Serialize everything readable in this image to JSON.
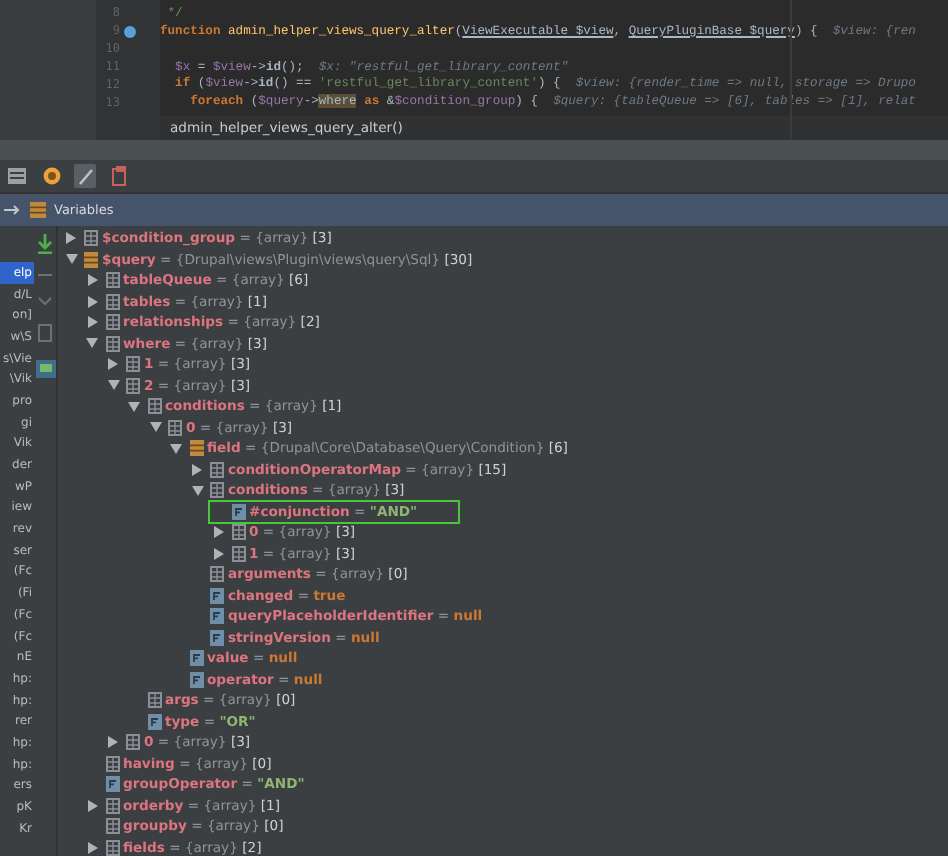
{
  "editor": {
    "lines": [
      {
        "number": "8",
        "tokens": [
          {
            "kind": "comment",
            "text": " */"
          }
        ]
      },
      {
        "number": "9",
        "breakpoint": true,
        "tokens": [
          {
            "kind": "keyword",
            "text": "function "
          },
          {
            "kind": "function",
            "text": "admin_helper_views_query_alter"
          },
          {
            "kind": "plain",
            "text": "("
          },
          {
            "kind": "type",
            "text": "ViewExecutable $view"
          },
          {
            "kind": "plain",
            "text": ", "
          },
          {
            "kind": "type",
            "text": "QueryPluginBase $query"
          },
          {
            "kind": "plain",
            "text": ") {  "
          },
          {
            "kind": "hint",
            "text": "$view: {ren"
          }
        ]
      },
      {
        "number": "10"
      },
      {
        "number": "11",
        "tokens": [
          {
            "kind": "variable",
            "text": "  $x"
          },
          {
            "kind": "plain",
            "text": " = "
          },
          {
            "kind": "variable",
            "text": "$view"
          },
          {
            "kind": "plain",
            "text": "->"
          },
          {
            "kind": "bold",
            "text": "id"
          },
          {
            "kind": "plain",
            "text": "();  "
          },
          {
            "kind": "hint",
            "text": "$x: \"restful_get_library_content\""
          }
        ]
      },
      {
        "number": "12",
        "tokens": [
          {
            "kind": "keyword",
            "text": "  if "
          },
          {
            "kind": "plain",
            "text": "("
          },
          {
            "kind": "variable",
            "text": "$view"
          },
          {
            "kind": "plain",
            "text": "->"
          },
          {
            "kind": "bold",
            "text": "id"
          },
          {
            "kind": "plain",
            "text": "() == "
          },
          {
            "kind": "string",
            "text": "'restful_get_library_content'"
          },
          {
            "kind": "plain",
            "text": ") {  "
          },
          {
            "kind": "hint",
            "text": "$view: {render_time => null, storage => Drupo"
          }
        ]
      },
      {
        "number": "13",
        "tokens": [
          {
            "kind": "keyword",
            "text": "    foreach "
          },
          {
            "kind": "plain",
            "text": "("
          },
          {
            "kind": "variable",
            "text": "$query"
          },
          {
            "kind": "plain",
            "text": "->"
          },
          {
            "kind": "match",
            "text": "where"
          },
          {
            "kind": "keyword",
            "text": " as "
          },
          {
            "kind": "plain",
            "text": "&"
          },
          {
            "kind": "variable",
            "text": "$condition_group"
          },
          {
            "kind": "plain",
            "text": ") {  "
          },
          {
            "kind": "hint",
            "text": "$query: {tableQueue => [6], tables => [1], relat"
          }
        ]
      }
    ],
    "breadcrumb": "admin_helper_views_query_alter()"
  },
  "panel": {
    "title": "Variables"
  },
  "frames": [
    {
      "text": "elp",
      "selected": true
    },
    {
      "text": "d/L",
      "selected": false
    },
    {
      "text": "on]",
      "selected": false
    },
    {
      "text": "w\\S",
      "selected": false
    },
    {
      "text": "s\\Vie",
      "selected": false
    },
    {
      "text": "\\Vik",
      "selected": false
    },
    {
      "text": "pro",
      "selected": false
    },
    {
      "text": "gi",
      "selected": false
    },
    {
      "text": "Vik",
      "selected": false
    },
    {
      "text": "der",
      "selected": false
    },
    {
      "text": "wP",
      "selected": false
    },
    {
      "text": "iew",
      "selected": false
    },
    {
      "text": "rev",
      "selected": false
    },
    {
      "text": "ser",
      "selected": false
    },
    {
      "text": "(Fc",
      "selected": false
    },
    {
      "text": "(Fi",
      "selected": false
    },
    {
      "text": "(Fc",
      "selected": false
    },
    {
      "text": "(Fc",
      "selected": false
    },
    {
      "text": "nE",
      "selected": false
    },
    {
      "text": "hp:",
      "selected": false
    },
    {
      "text": "hp:",
      "selected": false
    },
    {
      "text": "rer",
      "selected": false
    },
    {
      "text": "hp:",
      "selected": false
    },
    {
      "text": "hp:",
      "selected": false
    },
    {
      "text": "ers",
      "selected": false
    },
    {
      "text": "pK",
      "selected": false
    },
    {
      "text": "Kr",
      "selected": false
    }
  ],
  "tree": [
    {
      "name": "$condition_group",
      "eq": "=",
      "kind": "array",
      "value": "{array}",
      "count": "[3]",
      "expanded": false
    },
    {
      "name": "$query",
      "eq": "=",
      "kind": "object",
      "value": "{Drupal\\views\\Plugin\\views\\query\\Sql}",
      "count": "[30]",
      "expanded": true,
      "children": [
        {
          "name": "tableQueue",
          "eq": "=",
          "kind": "array",
          "value": "{array}",
          "count": "[6]",
          "expanded": false
        },
        {
          "name": "tables",
          "eq": "=",
          "kind": "array",
          "value": "{array}",
          "count": "[1]",
          "expanded": false
        },
        {
          "name": "relationships",
          "eq": "=",
          "kind": "array",
          "value": "{array}",
          "count": "[2]",
          "expanded": false
        },
        {
          "name": "where",
          "eq": "=",
          "kind": "array",
          "value": "{array}",
          "count": "[3]",
          "expanded": true,
          "children": [
            {
              "name": "1",
              "eq": "=",
              "kind": "array",
              "value": "{array}",
              "count": "[3]",
              "expanded": false
            },
            {
              "name": "2",
              "eq": "=",
              "kind": "array",
              "value": "{array}",
              "count": "[3]",
              "expanded": true,
              "children": [
                {
                  "name": "conditions",
                  "eq": "=",
                  "kind": "array",
                  "value": "{array}",
                  "count": "[1]",
                  "expanded": true,
                  "children": [
                    {
                      "name": "0",
                      "eq": "=",
                      "kind": "array",
                      "value": "{array}",
                      "count": "[3]",
                      "expanded": true,
                      "children": [
                        {
                          "name": "field",
                          "eq": "=",
                          "kind": "object",
                          "value": "{Drupal\\Core\\Database\\Query\\Condition}",
                          "count": "[6]",
                          "expanded": true,
                          "children": [
                            {
                              "name": "conditionOperatorMap",
                              "eq": "=",
                              "kind": "array",
                              "value": "{array}",
                              "count": "[15]",
                              "expanded": false
                            },
                            {
                              "name": "conditions",
                              "eq": "=",
                              "kind": "array",
                              "value": "{array}",
                              "count": "[3]",
                              "expanded": true,
                              "children": [
                                {
                                  "name": "#conjunction",
                                  "eq": "=",
                                  "kind": "string",
                                  "value": "\"AND\"",
                                  "highlighted": true
                                },
                                {
                                  "name": "0",
                                  "eq": "=",
                                  "kind": "array",
                                  "value": "{array}",
                                  "count": "[3]",
                                  "expanded": false,
                                  "highlighted": false
                                },
                                {
                                  "name": "1",
                                  "eq": "=",
                                  "kind": "array",
                                  "value": "{array}",
                                  "count": "[3]",
                                  "expanded": false,
                                  "highlighted": false
                                }
                              ]
                            },
                            {
                              "name": "arguments",
                              "eq": "=",
                              "kind": "array",
                              "value": "{array}",
                              "count": "[0]"
                            },
                            {
                              "name": "changed",
                              "eq": "=",
                              "kind": "keyword",
                              "value": "true"
                            },
                            {
                              "name": "queryPlaceholderIdentifier",
                              "eq": "=",
                              "kind": "keyword",
                              "value": "null"
                            },
                            {
                              "name": "stringVersion",
                              "eq": "=",
                              "kind": "keyword",
                              "value": "null"
                            }
                          ]
                        },
                        {
                          "name": "value",
                          "eq": "=",
                          "kind": "keyword",
                          "value": "null"
                        },
                        {
                          "name": "operator",
                          "eq": "=",
                          "kind": "keyword",
                          "value": "null"
                        }
                      ]
                    }
                  ]
                },
                {
                  "name": "args",
                  "eq": "=",
                  "kind": "array",
                  "value": "{array}",
                  "count": "[0]"
                },
                {
                  "name": "type",
                  "eq": "=",
                  "kind": "string",
                  "value": "\"OR\""
                }
              ]
            },
            {
              "name": "0",
              "eq": "=",
              "kind": "array",
              "value": "{array}",
              "count": "[3]",
              "expanded": false
            }
          ]
        },
        {
          "name": "having",
          "eq": "=",
          "kind": "array",
          "value": "{array}",
          "count": "[0]"
        },
        {
          "name": "groupOperator",
          "eq": "=",
          "kind": "string",
          "value": "\"AND\""
        },
        {
          "name": "orderby",
          "eq": "=",
          "kind": "array",
          "value": "{array}",
          "count": "[1]",
          "expanded": false
        },
        {
          "name": "groupby",
          "eq": "=",
          "kind": "array",
          "value": "{array}",
          "count": "[0]"
        },
        {
          "name": "fields",
          "eq": "=",
          "kind": "array",
          "value": "{array}",
          "count": "[2]",
          "expanded": false
        }
      ]
    }
  ]
}
